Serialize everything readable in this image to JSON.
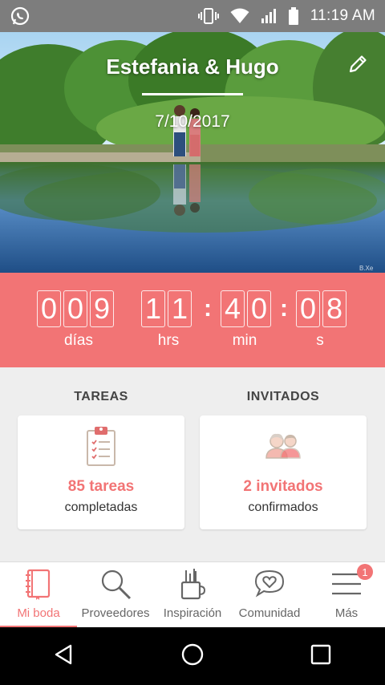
{
  "status_bar": {
    "time": "11:19 AM",
    "icons": [
      "whatsapp-icon",
      "vibrate-icon",
      "wifi-icon",
      "signal-icon",
      "battery-icon"
    ]
  },
  "hero": {
    "couple_name": "Estefania & Hugo",
    "wedding_date": "7/10/2017",
    "watermark": "B.Xe"
  },
  "countdown": {
    "days": [
      "0",
      "0",
      "9"
    ],
    "hours": [
      "1",
      "1"
    ],
    "minutes": [
      "4",
      "0"
    ],
    "seconds": [
      "0",
      "8"
    ],
    "separator": ":",
    "labels": {
      "days": "días",
      "hours": "hrs",
      "minutes": "min",
      "seconds": "s"
    }
  },
  "dashboard": {
    "tasks": {
      "title": "TAREAS",
      "value": "85 tareas",
      "subtitle": "completadas",
      "icon": "clipboard-checklist-icon"
    },
    "guests": {
      "title": "INVITADOS",
      "value": "2 invitados",
      "subtitle": "confirmados",
      "icon": "couple-guests-icon"
    }
  },
  "bottom_nav": {
    "items": [
      {
        "label": "Mi boda",
        "icon": "notebook-icon",
        "active": true
      },
      {
        "label": "Proveedores",
        "icon": "search-icon",
        "active": false
      },
      {
        "label": "Inspiración",
        "icon": "cup-pencils-icon",
        "active": false
      },
      {
        "label": "Comunidad",
        "icon": "heart-chat-icon",
        "active": false
      },
      {
        "label": "Más",
        "icon": "menu-icon",
        "active": false,
        "badge": "1"
      }
    ]
  },
  "colors": {
    "accent": "#f27475",
    "status_bar": "#7d7d7d",
    "system_nav": "#000000"
  }
}
